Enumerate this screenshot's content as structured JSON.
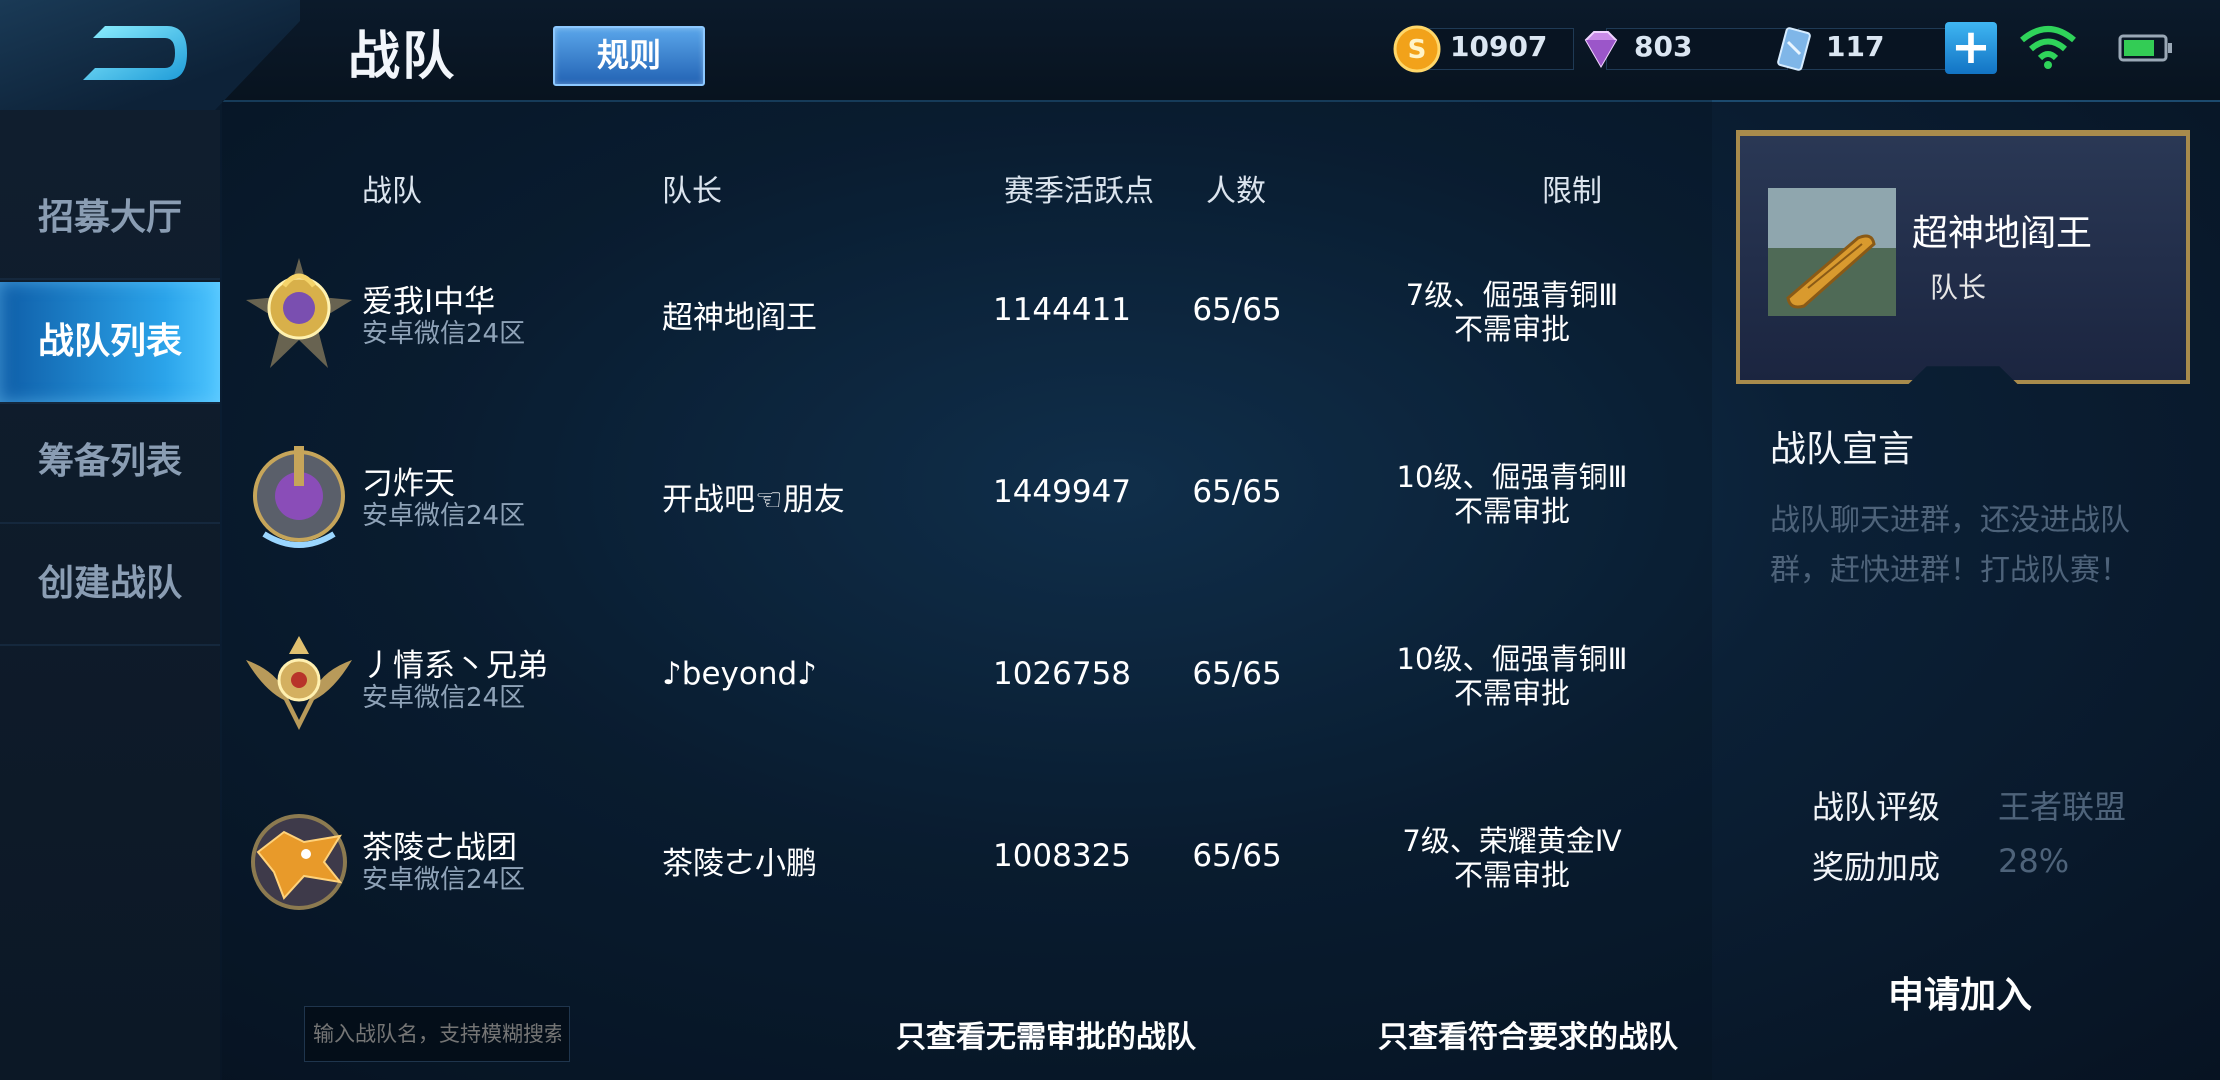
{
  "header": {
    "title": "战队",
    "rules_label": "规则"
  },
  "resources": {
    "gold": "10907",
    "diamond": "803",
    "voucher": "117",
    "add_label": "+"
  },
  "sidebar": {
    "items": [
      {
        "label": "招募大厅"
      },
      {
        "label": "战队列表"
      },
      {
        "label": "筹备列表"
      },
      {
        "label": "创建战队"
      }
    ],
    "active_index": 1
  },
  "table": {
    "headers": {
      "team": "战队",
      "captain": "队长",
      "points": "赛季活跃点",
      "members": "人数",
      "limit": "限制"
    },
    "rows": [
      {
        "name": "爱我I中华",
        "server": "安卓微信24区",
        "captain": "超神地阎王",
        "points": "1144411",
        "members": "65/65",
        "limit_level": "7级、倔强青铜Ⅲ",
        "limit_approval": "不需审批"
      },
      {
        "name": "刁炸天",
        "server": "安卓微信24区",
        "captain": "开战吧☜朋友",
        "points": "1449947",
        "members": "65/65",
        "limit_level": "10级、倔强青铜Ⅲ",
        "limit_approval": "不需审批"
      },
      {
        "name": "丿情系丶兄弟",
        "server": "安卓微信24区",
        "captain": "♪beyond♪",
        "points": "1026758",
        "members": "65/65",
        "limit_level": "10级、倔强青铜Ⅲ",
        "limit_approval": "不需审批"
      },
      {
        "name": "茶陵ㄜ战团",
        "server": "安卓微信24区",
        "captain": "茶陵ㄜ小鹏",
        "points": "1008325",
        "members": "65/65",
        "limit_level": "7级、荣耀黄金Ⅳ",
        "limit_approval": "不需审批"
      }
    ]
  },
  "search": {
    "placeholder": "输入战队名，支持模糊搜索"
  },
  "filters": {
    "no_approval": "只查看无需审批的战队",
    "eligible": "只查看符合要求的战队"
  },
  "detail": {
    "captain_name": "超神地阎王",
    "captain_role": "队长",
    "declaration_title": "战队宣言",
    "declaration_text": "战队聊天进群，还没进战队群，赶快进群！打战队赛！",
    "rating_label": "战队评级",
    "rating_value": "王者联盟",
    "bonus_label": "奖励加成",
    "bonus_value": "28%",
    "join_label": "申请加入"
  },
  "colors": {
    "accent_blue": "#2ba4ea",
    "gold_frame": "#a88b4c",
    "muted_text": "#4e637a"
  }
}
